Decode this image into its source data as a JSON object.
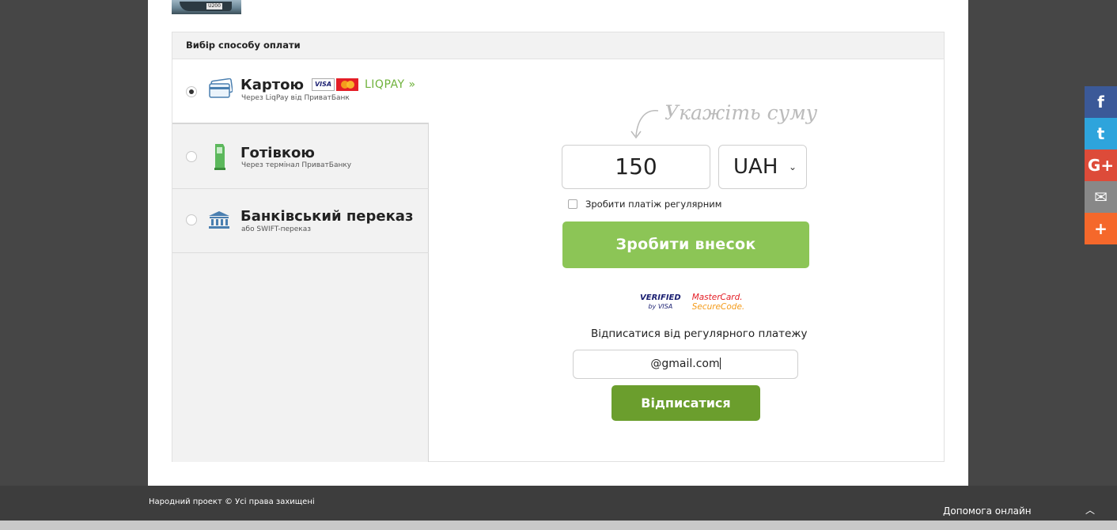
{
  "header_image": {
    "alt": "boat",
    "plate": "U200"
  },
  "panel": {
    "header": "Вибір способу оплати",
    "methods": [
      {
        "title": "Картою",
        "subtitle": "Через LiqPay від ПриватБанк",
        "icon": "credit-card-icon",
        "selected": true
      },
      {
        "title": "Готівкою",
        "subtitle": "Через термінал ПриватБанку",
        "icon": "terminal-icon",
        "selected": false
      },
      {
        "title": "Банківський переказ",
        "subtitle": "або SWIFT-переказ",
        "icon": "bank-icon",
        "selected": false
      }
    ],
    "card_logos": {
      "visa": "VISA",
      "liqpay": "LIQPAY"
    }
  },
  "form": {
    "hint": "Укажіть суму",
    "amount": "150",
    "currency": "UAH",
    "recurring_label": "Зробити платіж регулярним",
    "donate_button": "Зробити внесок",
    "secure": {
      "visa_line1": "VERIFIED",
      "visa_line2": "by VISA",
      "mc_line1": "MasterCard.",
      "mc_line2": "SecureCode."
    },
    "unsubscribe_label": "Відписатися від регулярного платежу",
    "email_value": "@gmail.com",
    "unsubscribe_button": "Відписатися"
  },
  "footer": {
    "copyright": "Народний проект © Усі права захищені",
    "help": "Допомога онлайн"
  },
  "share": [
    "f",
    "t",
    "G+",
    "✉",
    "+"
  ],
  "colors": {
    "green": "#8cc556",
    "dark_green": "#6b9e2d",
    "facebook": "#3b5998",
    "twitter": "#2ea4dc",
    "google": "#dd4b39",
    "email": "#888888",
    "more": "#f5682b"
  }
}
